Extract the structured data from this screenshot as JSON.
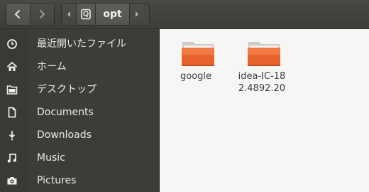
{
  "header": {
    "back_icon": "chevron-left-icon",
    "forward_icon": "chevron-right-icon",
    "path_left_icon": "caret-left-icon",
    "path_root_icon": "root-disk-icon",
    "path_right_icon": "caret-right-icon",
    "current_folder": "opt"
  },
  "sidebar": {
    "items": [
      {
        "label": "最近開いたファイル",
        "icon": "clock-icon"
      },
      {
        "label": "ホーム",
        "icon": "home-icon"
      },
      {
        "label": "デスクトップ",
        "icon": "folder-icon"
      },
      {
        "label": "Documents",
        "icon": "document-icon"
      },
      {
        "label": "Downloads",
        "icon": "download-icon"
      },
      {
        "label": "Music",
        "icon": "music-icon"
      },
      {
        "label": "Pictures",
        "icon": "camera-icon"
      }
    ]
  },
  "content": {
    "files": [
      {
        "name": "google",
        "icon": "folder-icon"
      },
      {
        "name": "idea-IC-182.4892.20",
        "icon": "folder-icon"
      }
    ]
  },
  "colors": {
    "header_bg": "#42403c",
    "sidebar_bg": "#3d3c38",
    "content_bg": "#f6f6f4",
    "folder_orange": "#e8622c"
  }
}
